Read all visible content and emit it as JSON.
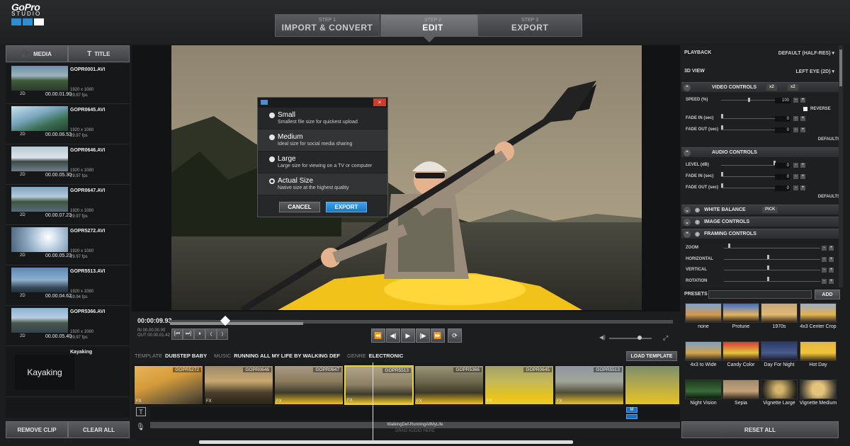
{
  "app": {
    "brand": "GoPro",
    "product": "STUDIO"
  },
  "steps": [
    {
      "num": "STEP 1",
      "label": "IMPORT & CONVERT"
    },
    {
      "num": "STEP 2",
      "label": "EDIT"
    },
    {
      "num": "STEP 3",
      "label": "EXPORT"
    }
  ],
  "left_tabs": {
    "media": "MEDIA",
    "title": "TITLE"
  },
  "media": [
    {
      "name": "GOPR0001.AVI",
      "res": "1920 x 1080",
      "fps": "29.97 fps",
      "tag": "2D",
      "dur": "00.00.01.90"
    },
    {
      "name": "GOPR0645.AVI",
      "res": "1920 x 1080",
      "fps": "29.97 fps",
      "tag": "2D",
      "dur": "00.00.06.53"
    },
    {
      "name": "GOPR0646.AVI",
      "res": "1920 x 1080",
      "fps": "29.97 fps",
      "tag": "2D",
      "dur": "00.00.05.30"
    },
    {
      "name": "GOPR0647.AVI",
      "res": "1920 x 1080",
      "fps": "29.97 fps",
      "tag": "2D",
      "dur": "00.00.07.23"
    },
    {
      "name": "GOPR5272.AVI",
      "res": "1920 x 1080",
      "fps": "29.97 fps",
      "tag": "2D",
      "dur": "00.00.05.23"
    },
    {
      "name": "GOPR5513.AVI",
      "res": "1920 x 1080",
      "fps": "59.94 fps",
      "tag": "2D",
      "dur": "00.00.04.62"
    },
    {
      "name": "GOPR5366.AVI",
      "res": "1920 x 1080",
      "fps": "29.97 fps",
      "tag": "2D",
      "dur": "00.00.05.40"
    }
  ],
  "title_item": {
    "name": "Kayaking",
    "preview": "Kayaking"
  },
  "left_buttons": {
    "remove": "REMOVE CLIP",
    "clear": "CLEAR ALL"
  },
  "dialog": {
    "options": [
      {
        "name": "Small",
        "desc": "Smallest file size for quickest upload"
      },
      {
        "name": "Medium",
        "desc": "Ideal size for social media sharing"
      },
      {
        "name": "Large",
        "desc": "Large size for viewing on a TV or computer"
      },
      {
        "name": "Actual Size",
        "desc": "Native size at the highest quality"
      }
    ],
    "cancel": "CANCEL",
    "export": "EXPORT",
    "close": "×"
  },
  "playback": {
    "timecode": "00:00:09.93",
    "in": "IN  00.00.00.00",
    "out": "OUT 00.00.01.42",
    "progress": 0.265,
    "marker": 0.11
  },
  "template_bar": {
    "template_key": "TEMPLATE",
    "template_val": "DUBSTEP BABY",
    "music_key": "MUSIC",
    "music_val": "RUNNING ALL MY LIFE BY WALKING DEF",
    "genre_key": "GENRE",
    "genre_val": "ELECTRONIC",
    "load": "LOAD TEMPLATE"
  },
  "timeline": {
    "clips": [
      "GOPR5272",
      "GOPR0646",
      "GOPR0647",
      "GOPR5513",
      "GOPR5366",
      "GOPR0645",
      "GOPR5513",
      ""
    ],
    "fx": "FX",
    "audio": "WalkingDef-RunningAllMyLife",
    "drag_audio": "DRAG AUDIO HERE"
  },
  "right": {
    "playback_label": "PLAYBACK",
    "playback_val": "DEFAULT (HALF-RES)",
    "view_label": "3D VIEW",
    "view_val": "LEFT EYE (2D)",
    "video_controls": "VIDEO CONTROLS",
    "x2a": "x2",
    "x2b": "x2",
    "speed_label": "SPEED (%)",
    "speed_val": "100",
    "reverse": "REVERSE",
    "fadein_label": "FADE IN (sec)",
    "fadein_val": "0",
    "fadeout_label": "FADE OUT (sec)",
    "fadeout_val": "0",
    "defaults": "DEFAULTS",
    "audio_controls": "AUDIO CONTROLS",
    "level_label": "LEVEL (dB)",
    "level_val": "0",
    "afadein_label": "FADE IN (sec)",
    "afadein_val": "0",
    "afadeout_label": "FADE OUT (sec)",
    "afadeout_val": "0",
    "adefaults": "DEFAULTS",
    "white_balance": "WHITE BALANCE",
    "pick": "PICK",
    "image_controls": "IMAGE CONTROLS",
    "framing_controls": "FRAMING CONTROLS",
    "zoom": "ZOOM",
    "horizontal": "HORIZONTAL",
    "vertical": "VERTICAL",
    "rotation": "ROTATION"
  },
  "presets": {
    "label": "PRESETS",
    "add": "ADD",
    "items": [
      "none",
      "Protune",
      "1970s",
      "4x3 Center Crop",
      "4x3 to Wide",
      "Candy Color",
      "Day For Night",
      "Hot Day",
      "Night Vision",
      "Sepia",
      "Vignette Large",
      "Vignette Medium"
    ],
    "reset": "RESET ALL"
  },
  "colors": {
    "accent": "#2a8fd6",
    "selected_clip": "#e8d23a",
    "close": "#d23a2d"
  }
}
